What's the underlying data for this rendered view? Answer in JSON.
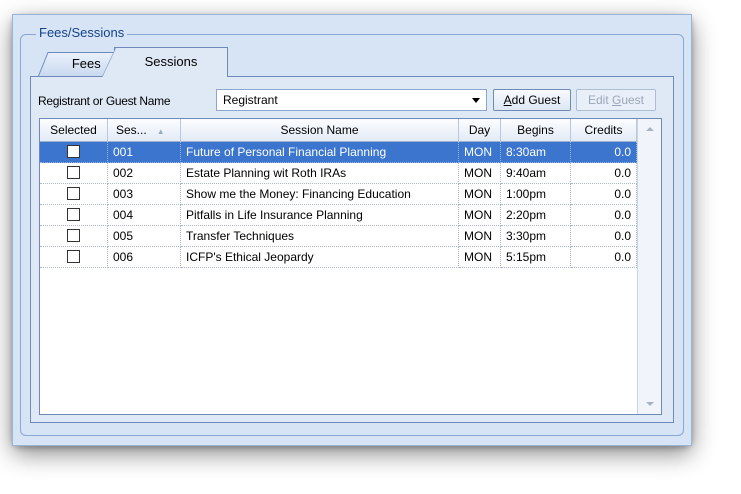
{
  "group": {
    "title": "Fees/Sessions"
  },
  "tabs": [
    {
      "label": "Fees"
    },
    {
      "label": "Sessions"
    }
  ],
  "registrant": {
    "label": "Registrant or Guest Name",
    "value": "Registrant"
  },
  "buttons": {
    "add_guest": {
      "pre": "",
      "accel": "A",
      "post": "dd Guest"
    },
    "edit_guest": {
      "pre": "Edit ",
      "accel": "G",
      "post": "uest"
    }
  },
  "grid": {
    "columns": [
      "Selected",
      "Ses...",
      "Session Name",
      "Day",
      "Begins",
      "Credits"
    ],
    "rows": [
      {
        "num": "001",
        "name": "Future of Personal Financial Planning",
        "day": "MON",
        "begins": "8:30am",
        "credits": "0.0",
        "selected_row": true
      },
      {
        "num": "002",
        "name": "Estate Planning wit Roth IRAs",
        "day": "MON",
        "begins": "9:40am",
        "credits": "0.0"
      },
      {
        "num": "003",
        "name": "Show me the Money: Financing Education",
        "day": "MON",
        "begins": "1:00pm",
        "credits": "0.0"
      },
      {
        "num": "004",
        "name": "Pitfalls in Life Insurance Planning",
        "day": "MON",
        "begins": "2:20pm",
        "credits": "0.0"
      },
      {
        "num": "005",
        "name": "Transfer Techniques",
        "day": "MON",
        "begins": "3:30pm",
        "credits": "0.0"
      },
      {
        "num": "006",
        "name": "ICFP's Ethical Jeopardy",
        "day": "MON",
        "begins": "5:15pm",
        "credits": "0.0"
      }
    ]
  },
  "colors": {
    "selection": "#3b75ce",
    "frame": "#d7e4f5",
    "title_text": "#15428b"
  }
}
